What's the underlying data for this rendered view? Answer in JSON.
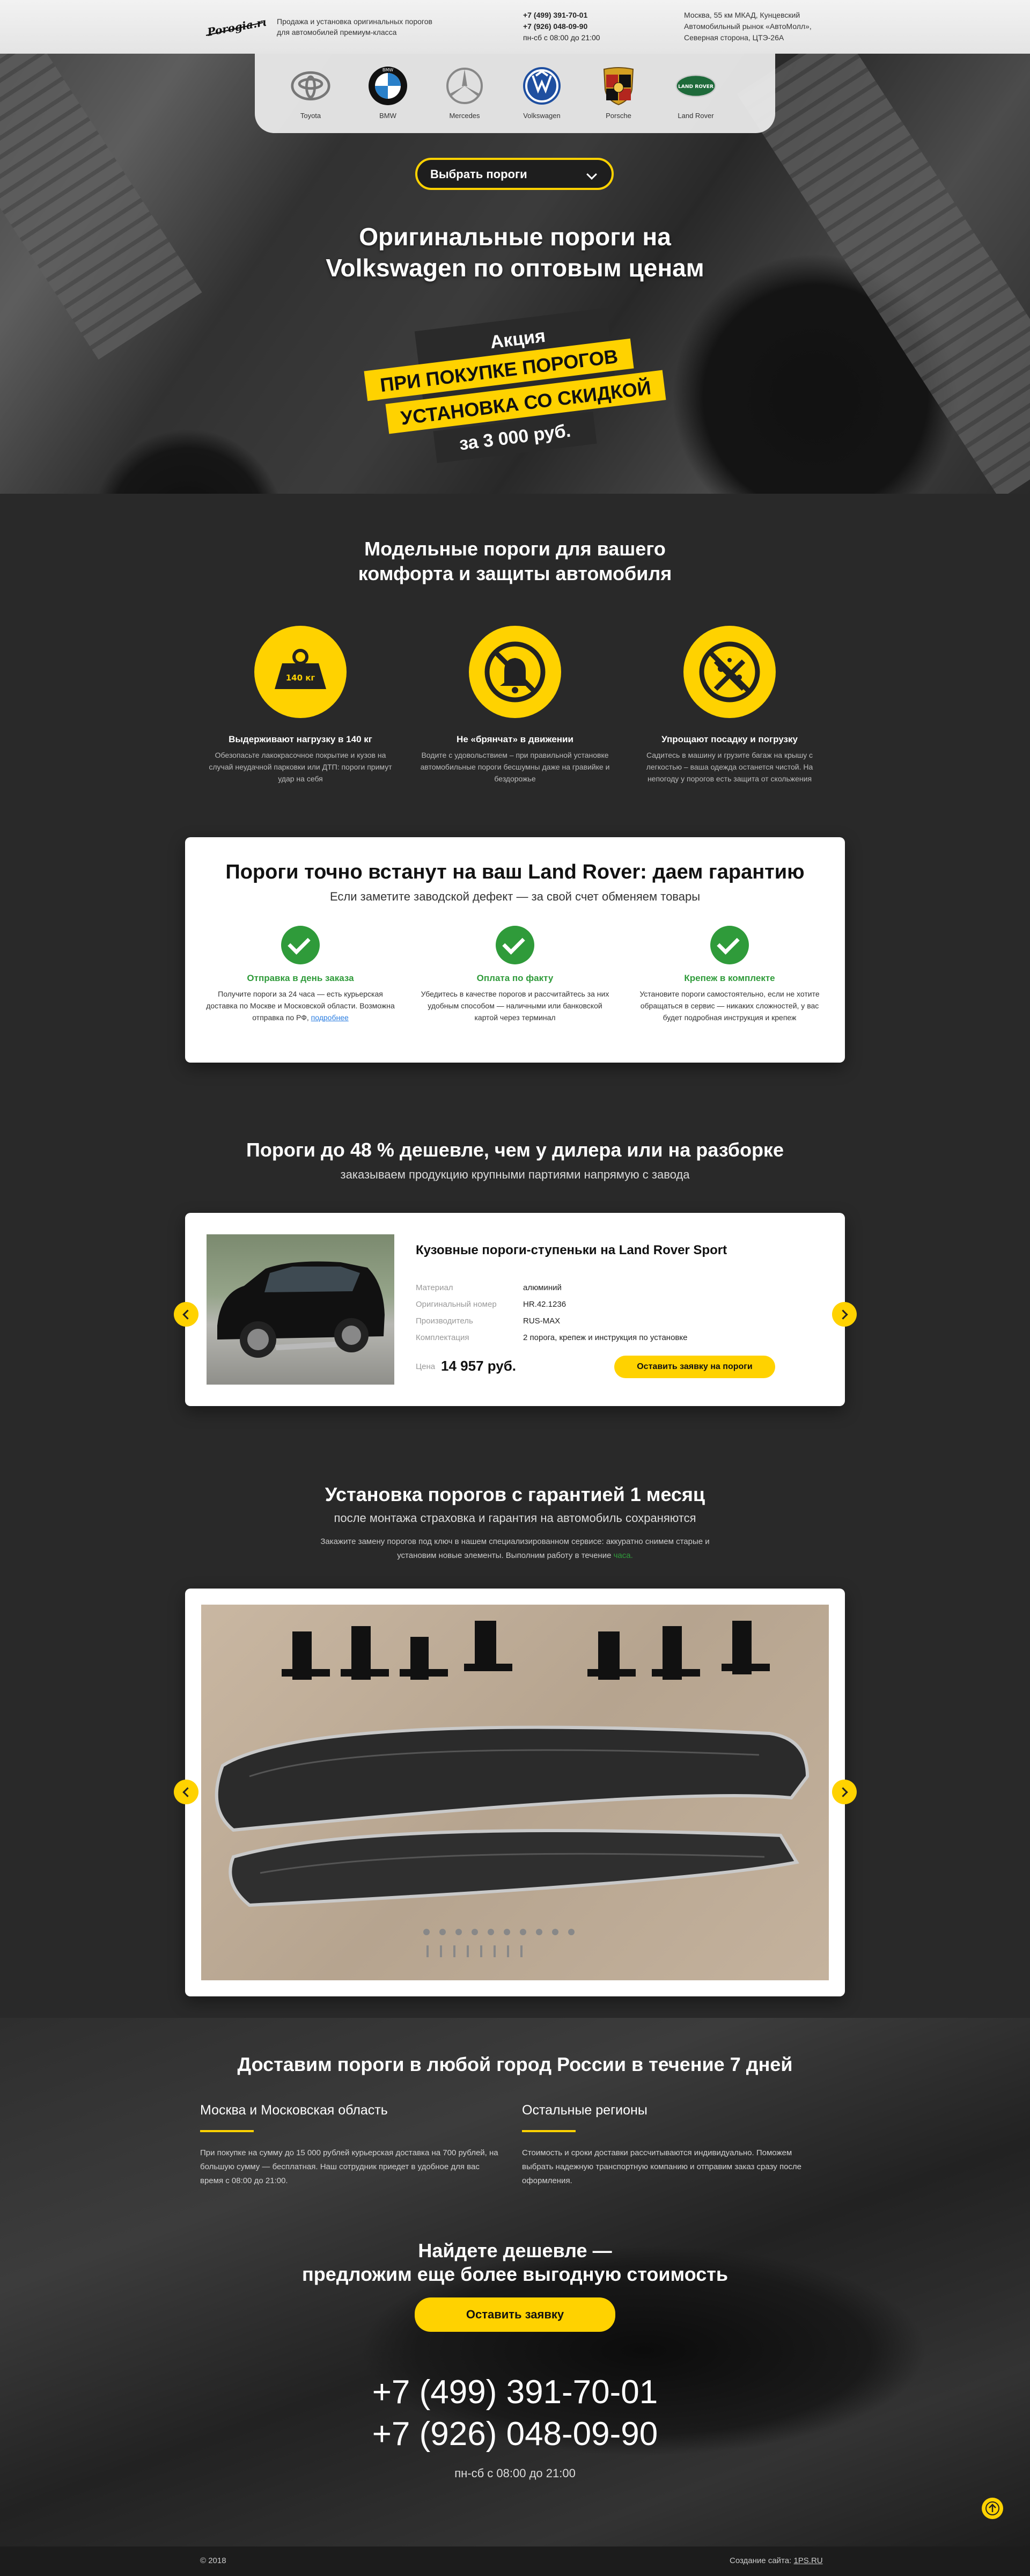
{
  "header": {
    "logo_text": "Porogia.ru",
    "tagline": "Продажа и установка оригинальных порогов для автомобилей премиум-класса",
    "phone1": "+7 (499) 391-70-01",
    "phone2": "+7 (926) 048-09-90",
    "hours": "пн-сб с 08:00 до 21:00",
    "address": "Москва, 55 км МКАД, Кунцевский Автомобильный рынок «АвтоМолл», Северная сторона, ЦТЭ-26А"
  },
  "brands": [
    {
      "label": "Toyota",
      "icon": "toyota-logo-icon"
    },
    {
      "label": "BMW",
      "icon": "bmw-logo-icon"
    },
    {
      "label": "Mercedes",
      "icon": "mercedes-logo-icon"
    },
    {
      "label": "Volkswagen",
      "icon": "volkswagen-logo-icon"
    },
    {
      "label": "Porsche",
      "icon": "porsche-logo-icon"
    },
    {
      "label": "Land Rover",
      "icon": "land-rover-logo-icon"
    }
  ],
  "landrover_badge": "LAND ROVER",
  "hero": {
    "select_label": "Выбрать пороги",
    "title_line1": "Оригинальные пороги на",
    "title_line2": "Volkswagen по оптовым ценам",
    "promo_l1": "Акция",
    "promo_l2": "ПРИ ПОКУПКЕ ПОРОГОВ",
    "promo_l3": "УСТАНОВКА СО СКИДКОЙ",
    "promo_l4": "за 3 000 руб."
  },
  "features": {
    "title_l1": "Модельные пороги для вашего",
    "title_l2": "комфорта и защиты автомобиля",
    "weight_label": "140 кг",
    "items": [
      {
        "title": "Выдерживают нагрузку в 140 кг",
        "text": "Обезопасьте лакокрасочное покрытие и кузов на случай неудачной парковки или ДТП: пороги примут удар на себя"
      },
      {
        "title": "Не «брянчат» в движении",
        "text": "Водите с удовольствием – при правильной установке автомобильные пороги бесшумны даже на гравийке и бездорожье"
      },
      {
        "title": "Упрощают посадку и погрузку",
        "text": "Садитесь в машину и грузите багаж на крышу с легкостью – ваша одежда останется чистой. На непогоду у порогов есть защита от скольжения"
      }
    ]
  },
  "guarantee": {
    "title": "Пороги точно встанут на ваш Land Rover: даем гарантию",
    "subtitle": "Если заметите заводской дефект — за свой счет обменяем товары",
    "items": [
      {
        "title": "Отправка в день заказа",
        "text": "Получите пороги за 24 часа — есть курьерская доставка по Москве и Московской области. Возможна отправка по РФ,",
        "link": "подробнее"
      },
      {
        "title": "Оплата по факту",
        "text": "Убедитесь в качестве порогов и рассчитайтесь за них удобным способом — наличными или банковской картой через терминал"
      },
      {
        "title": "Крепеж в комплекте",
        "text": "Установите пороги самостоятельно, если не хотите обращаться в сервис — никаких сложностей, у вас будет подробная инструкция и крепеж"
      }
    ]
  },
  "price": {
    "title": "Пороги до 48 % дешевле, чем у дилера или на разборке",
    "subtitle": "заказываем продукцию крупными партиями напрямую с завода"
  },
  "product": {
    "name": "Кузовные пороги-ступеньки на Land Rover Sport",
    "specs": [
      {
        "k": "Материал",
        "v": "алюминий"
      },
      {
        "k": "Оригинальный номер",
        "v": "HR.42.1236"
      },
      {
        "k": "Производитель",
        "v": "RUS-MAX"
      },
      {
        "k": "Комплектация",
        "v": "2 порога, крепеж и инструкция по установке"
      }
    ],
    "price_label": "Цена",
    "price": "14 957 руб.",
    "button": "Оставить заявку на пороги"
  },
  "install": {
    "title": "Установка порогов с гарантией 1 месяц",
    "subtitle": "после монтажа страховка и гарантия на автомобиль сохраняются",
    "text": "Закажите замену порогов под ключ в нашем специализированном сервисе: аккуратно снимем старые и установим новые элементы. Выполним работу в течение",
    "link": "часа."
  },
  "delivery": {
    "title": "Доставим пороги в любой город России в течение 7 дней",
    "moscow_title": "Москва и Московская область",
    "moscow_text": "При покупке на сумму до 15 000 рублей курьерская доставка на 700 рублей, на большую сумму — бесплатная. Наш сотрудник приедет в удобное для вас время с 08:00 до 21:00.",
    "regions_title": "Остальные регионы",
    "regions_text": "Стоимость и сроки доставки рассчитываются индивидуально. Поможем выбрать надежную транспортную компанию и отправим заказ сразу после оформления."
  },
  "cta": {
    "title_l1": "Найдете дешевле —",
    "title_l2": "предложим еще более выгодную стоимость",
    "button": "Оставить заявку",
    "phone1": "+7 (499) 391-70-01",
    "phone2": "+7 (926) 048-09-90",
    "hours": "пн-сб с 08:00 до 21:00"
  },
  "footer": {
    "copyright": "© 2018",
    "made_label": "Создание сайта:",
    "made_link": "1PS.RU"
  }
}
